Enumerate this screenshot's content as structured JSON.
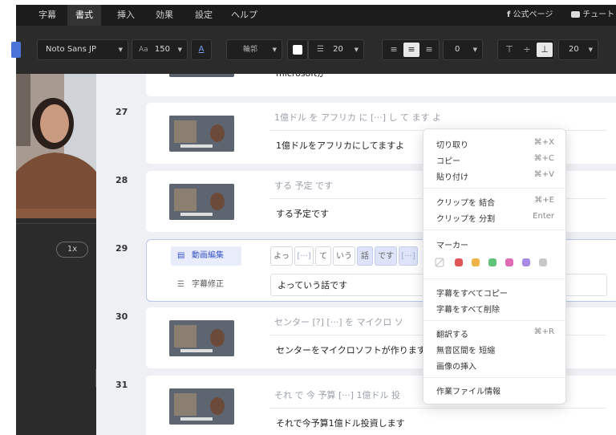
{
  "menubar": {
    "items": [
      "字幕",
      "書式",
      "挿入",
      "効果",
      "設定",
      "ヘルプ"
    ],
    "active": "書式",
    "link_facebook": "公式ページ",
    "link_youtube": "チュートリ"
  },
  "toolbar": {
    "font": "Noto Sans JP",
    "font_size_icon": "Aa",
    "font_size": "150",
    "text_color_icon": "A",
    "outline_label": "輪郭",
    "line_spacing": "20",
    "align_offset": "0",
    "position_offset": "20"
  },
  "left": {
    "speed": "1x",
    "collapse_icon": ">"
  },
  "rows": [
    {
      "num": "27",
      "words": "1億ドル を アフリカ に [···] し て ます よ",
      "sub": "1億ドルをアフリカにしてますよ"
    },
    {
      "num": "28",
      "words": "する 予定 です",
      "sub": "する予定です"
    },
    {
      "num": "29",
      "tab_video": "動画編集",
      "tab_sub": "字幕修正",
      "chips": [
        "よっ",
        "[···]",
        "て",
        "いう",
        "話",
        "です",
        "[···]"
      ],
      "sub": "よっていう話です"
    },
    {
      "num": "30",
      "words": "センター [?] [···] を マイクロ ソ",
      "sub": "センターをマイクロソフトが作ります"
    },
    {
      "num": "31",
      "words": "それ で 今 予算 [···] 1億ドル 投",
      "sub": "それで今予算1億ドル投資します"
    }
  ],
  "partial_row_text": "microsoftが",
  "context_menu": {
    "cut": "切り取り",
    "cut_sc": "⌘+X",
    "copy": "コピー",
    "copy_sc": "⌘+C",
    "paste": "貼り付け",
    "paste_sc": "⌘+V",
    "merge": "クリップを 結合",
    "merge_sc": "⌘+E",
    "split": "クリップを 分割",
    "split_sc": "Enter",
    "marker_label": "マーカー",
    "marker_colors": [
      "#e05656",
      "#f0b446",
      "#5fc47a",
      "#e06bb5",
      "#a98be6",
      "#c8c8c8"
    ],
    "copy_all": "字幕をすべてコピー",
    "delete_all": "字幕をすべて削除",
    "translate": "翻訳する",
    "translate_sc": "⌘+R",
    "shorten_silence": "無音区間を 短縮",
    "insert_image": "画像の挿入",
    "file_info": "作業ファイル情報"
  }
}
